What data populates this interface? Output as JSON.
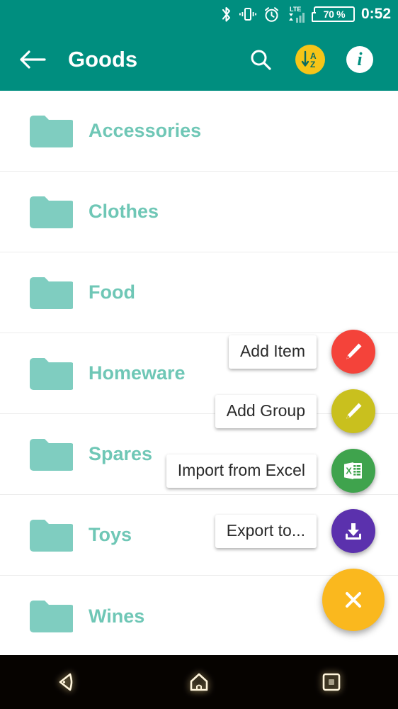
{
  "status_bar": {
    "icons": [
      "bluetooth-icon",
      "vibrate-icon",
      "alarm-icon",
      "lte-signal-icon"
    ],
    "battery_level": "70 %",
    "time": "0:52"
  },
  "toolbar": {
    "back_icon": "back-arrow-icon",
    "title": "Goods",
    "search_icon": "search-icon",
    "sort_icon": "sort-az-icon",
    "sort_letters": {
      "top": "A",
      "bottom": "Z"
    },
    "info_icon": "info-icon",
    "info_glyph": "i",
    "background_color": "#008e7f"
  },
  "list": {
    "rows": [
      {
        "label": "Accessories",
        "icon": "folder-icon"
      },
      {
        "label": "Clothes",
        "icon": "folder-icon"
      },
      {
        "label": "Food",
        "icon": "folder-icon"
      },
      {
        "label": "Homeware",
        "icon": "folder-icon"
      },
      {
        "label": "Spares",
        "icon": "folder-icon"
      },
      {
        "label": "Toys",
        "icon": "folder-icon"
      },
      {
        "label": "Wines",
        "icon": "folder-icon"
      }
    ],
    "folder_color": "#7fcdc0",
    "label_color": "#6fc7b6"
  },
  "fab_menu": {
    "expanded": true,
    "actions": [
      {
        "label": "Add Item",
        "icon": "pencil-icon",
        "color": "#f4433a"
      },
      {
        "label": "Add Group",
        "icon": "pencil-icon",
        "color": "#c9c01e"
      },
      {
        "label": "Import from Excel",
        "icon": "excel-icon",
        "color": "#3fa34d"
      },
      {
        "label": "Export to...",
        "icon": "download-icon",
        "color": "#5b31ad"
      }
    ],
    "main": {
      "icon": "close-icon",
      "color": "#fab81e"
    }
  },
  "nav_bar": {
    "back_icon": "nav-back-icon",
    "home_icon": "nav-home-icon",
    "recents_icon": "nav-recents-icon",
    "background_color": "#060300"
  }
}
